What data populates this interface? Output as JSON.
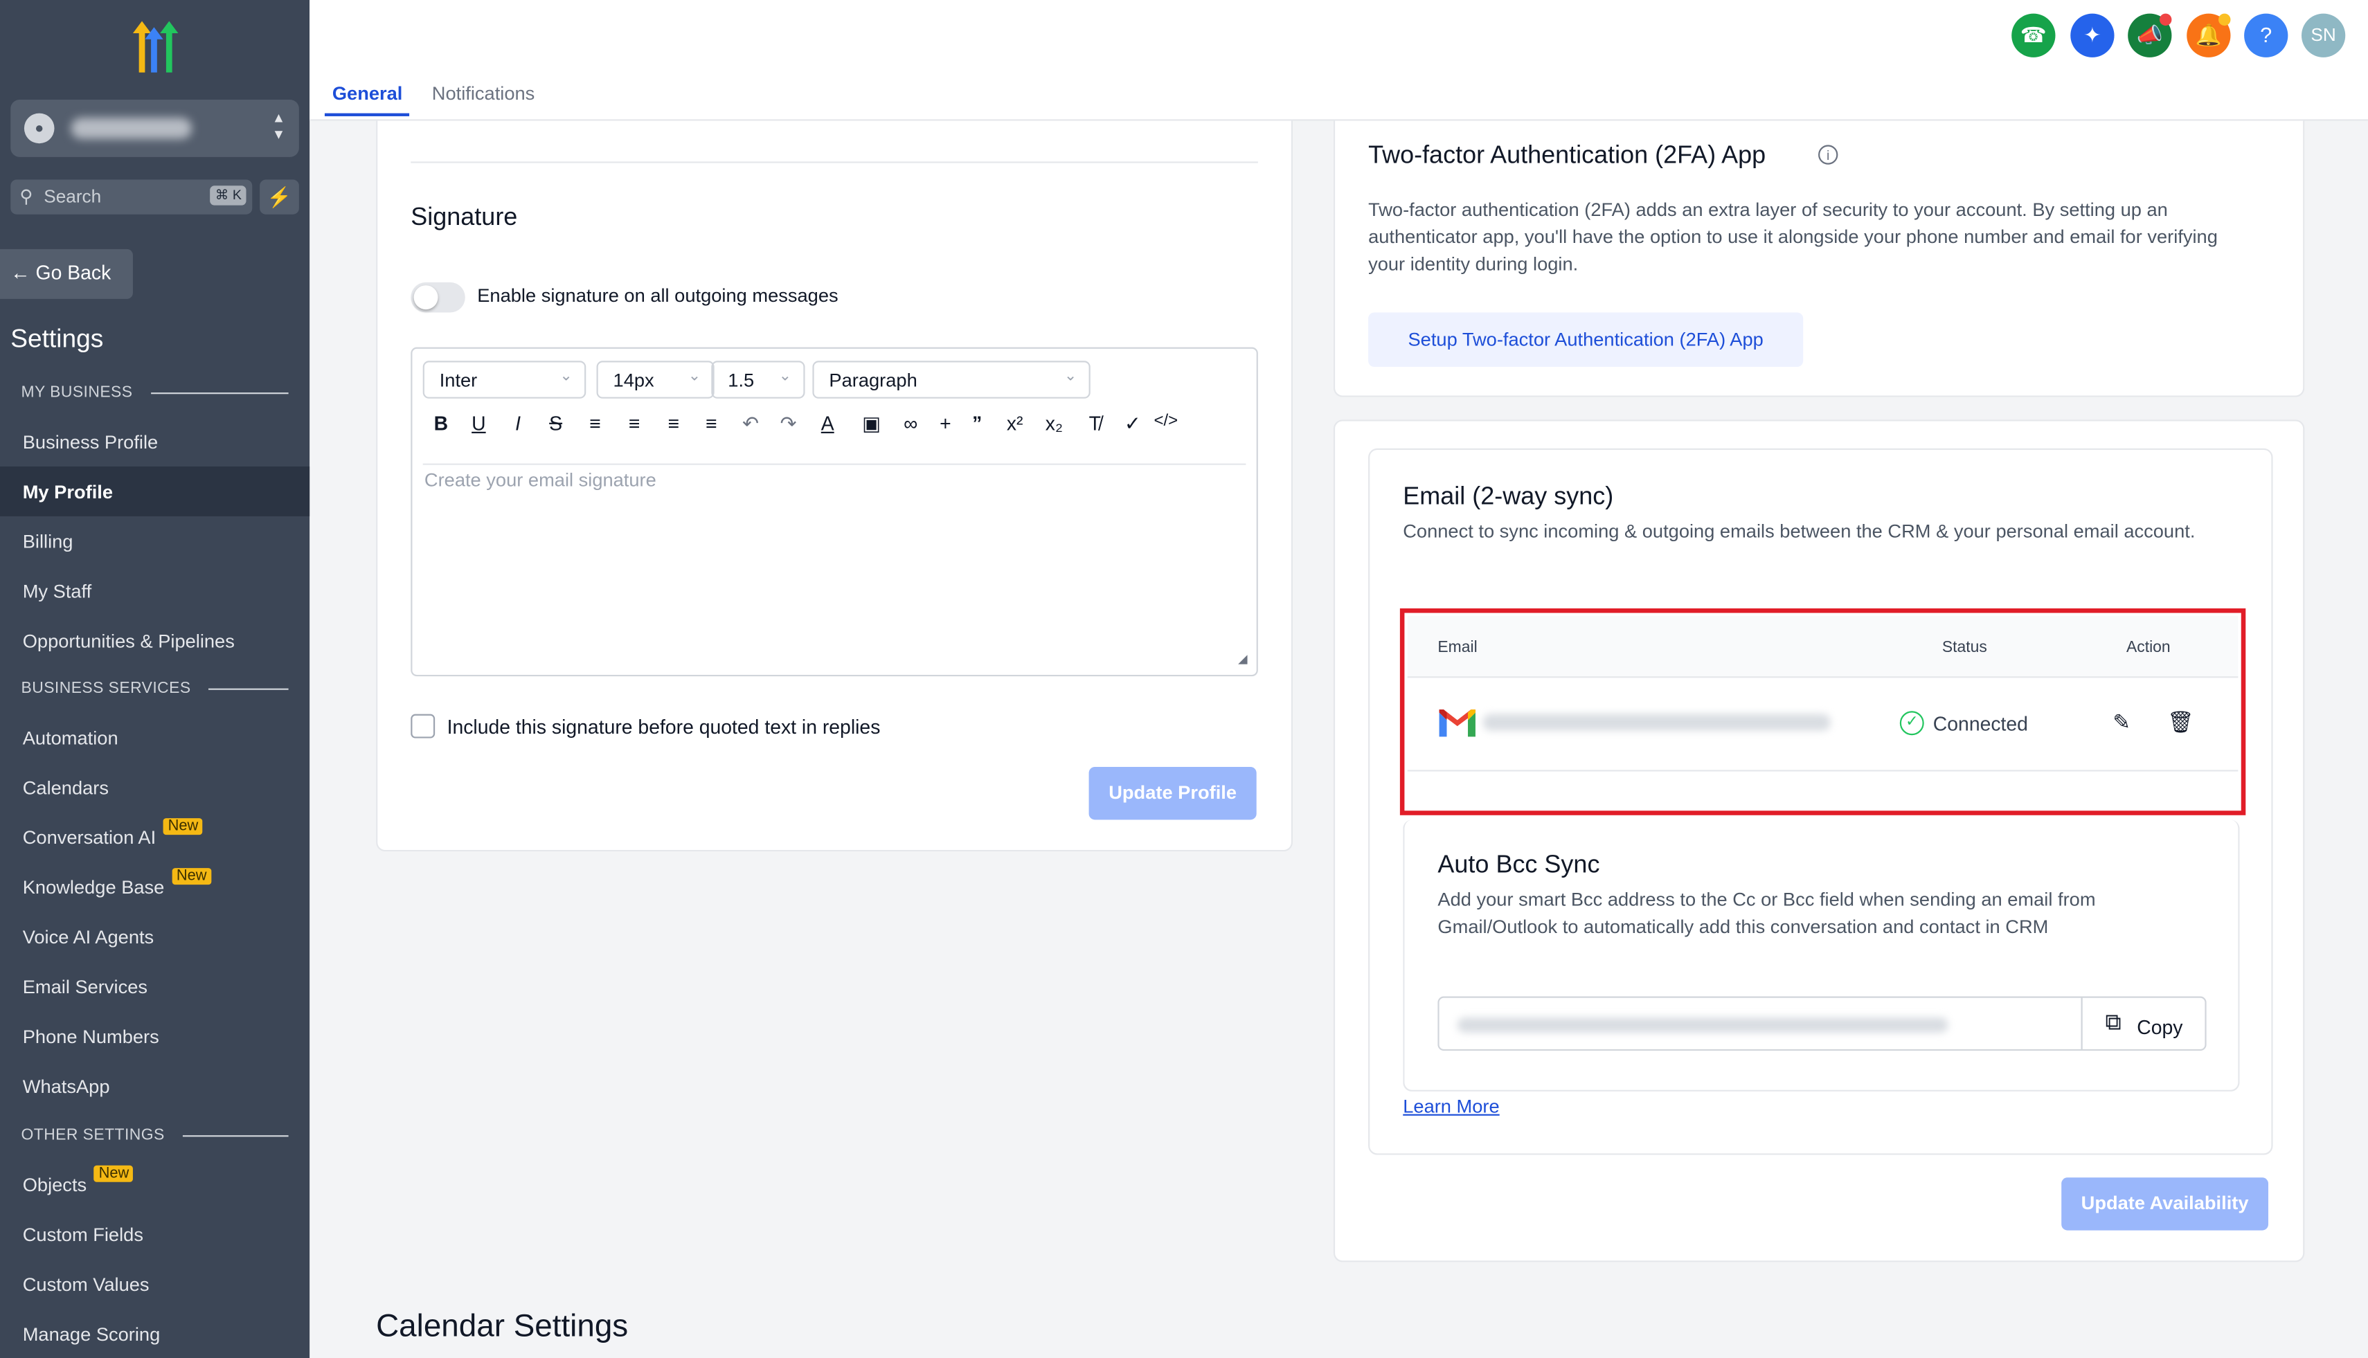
{
  "sidebar": {
    "search_placeholder": "Search",
    "search_shortcut": "⌘ K",
    "go_back": "Go Back",
    "title": "Settings",
    "sections": {
      "my_business": "MY BUSINESS",
      "business_services": "BUSINESS SERVICES",
      "other_settings": "OTHER SETTINGS"
    },
    "items": {
      "business_profile": "Business Profile",
      "my_profile": "My Profile",
      "billing": "Billing",
      "my_staff": "My Staff",
      "opportunities": "Opportunities & Pipelines",
      "automation": "Automation",
      "calendars": "Calendars",
      "conversation_ai": "Conversation AI",
      "knowledge_base": "Knowledge Base",
      "voice_ai": "Voice AI Agents",
      "email_services": "Email Services",
      "phone_numbers": "Phone Numbers",
      "whatsapp": "WhatsApp",
      "objects": "Objects",
      "custom_fields": "Custom Fields",
      "custom_values": "Custom Values",
      "manage_scoring": "Manage Scoring"
    },
    "badge_new": "New"
  },
  "topbar": {
    "tabs": {
      "general": "General",
      "notifications": "Notifications"
    },
    "user_initials": "SN",
    "help_glyph": "?",
    "colors": {
      "phone": "#16a34a",
      "sparkle": "#2563eb",
      "megaphone": "#15803d",
      "bell": "#f97316",
      "help": "#3b82f6",
      "avatar": "#8fb8c4"
    }
  },
  "signature": {
    "title": "Signature",
    "toggle_label": "Enable signature on all outgoing messages",
    "font": "Inter",
    "size": "14px",
    "line_height": "1.5",
    "block": "Paragraph",
    "placeholder": "Create your email signature",
    "include_label": "Include this signature before quoted text in replies",
    "update_button": "Update Profile"
  },
  "twofa": {
    "title": "Two-factor Authentication (2FA) App",
    "description": "Two-factor authentication (2FA) adds an extra layer of security to your account. By setting up an authenticator app, you'll have the option to use it alongside your phone number and email for verifying your identity during login.",
    "button": "Setup Two-factor Authentication (2FA) App"
  },
  "email_sync": {
    "title": "Email (2-way sync)",
    "description": "Connect to sync incoming & outgoing emails between the CRM & your personal email account.",
    "columns": {
      "email": "Email",
      "status": "Status",
      "action": "Action"
    },
    "status": "Connected",
    "status_color": "#22c55e"
  },
  "auto_bcc": {
    "title": "Auto Bcc Sync",
    "description": "Add your smart Bcc address to the Cc or Bcc field when sending an email from Gmail/Outlook to automatically add this conversation and contact in CRM",
    "copy_button": "Copy",
    "learn_more": "Learn More",
    "update_button": "Update Availability"
  },
  "calendar": {
    "title": "Calendar Settings"
  },
  "icons": [
    "phone-icon",
    "sparkle-icon",
    "megaphone-icon",
    "bell-icon",
    "help-icon",
    "search-icon",
    "bolt-icon",
    "arrow-left-icon",
    "gmail-icon",
    "check-circle-icon",
    "pencil-icon",
    "trash-icon",
    "copy-icon",
    "info-icon",
    "chevron-down-icon"
  ]
}
